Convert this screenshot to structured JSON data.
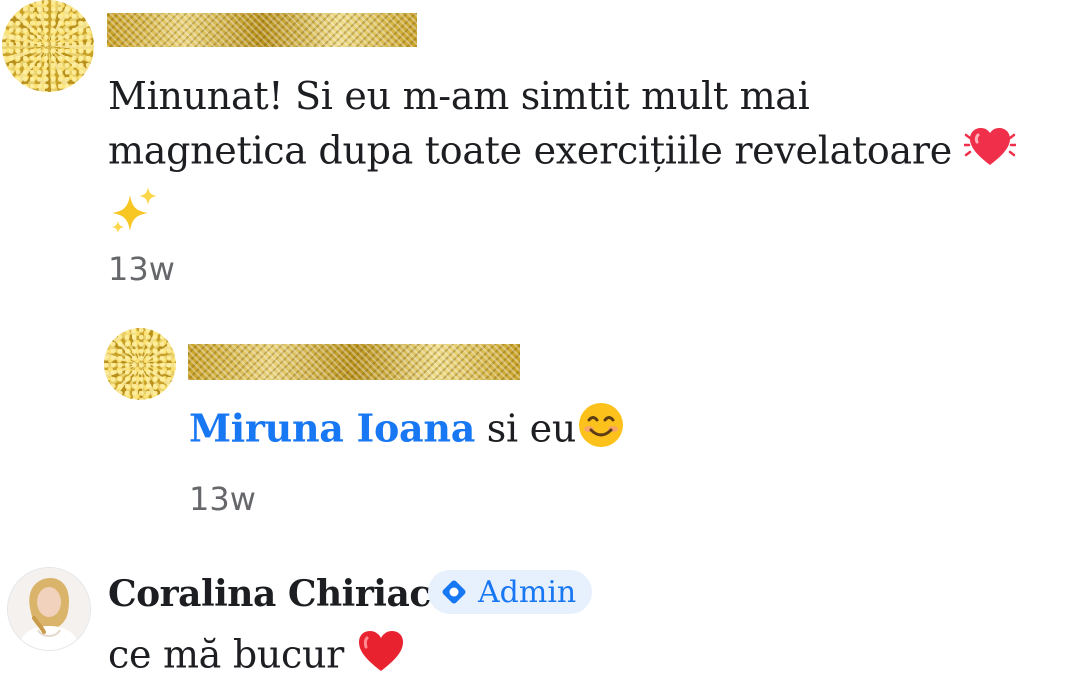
{
  "comments": [
    {
      "text_line1": "Minunat! Si eu m-am simtit mult mai",
      "text_line2": "magnetica dupa toate exercițiile revelatoare",
      "timestamp": "13w",
      "emoji_end": "beating-heart",
      "emoji_next": "sparkles"
    },
    {
      "mention": "Miruna Ioana",
      "text": " si eu",
      "emoji": "smiling-face",
      "timestamp": "13w"
    },
    {
      "author": "Coralina Chiriac",
      "badge": "Admin",
      "text": "ce mă bucur",
      "emoji": "red-heart"
    }
  ],
  "colors": {
    "mention": "#1877f2",
    "badge_bg": "#e7f0fd",
    "timestamp": "#65676b"
  }
}
